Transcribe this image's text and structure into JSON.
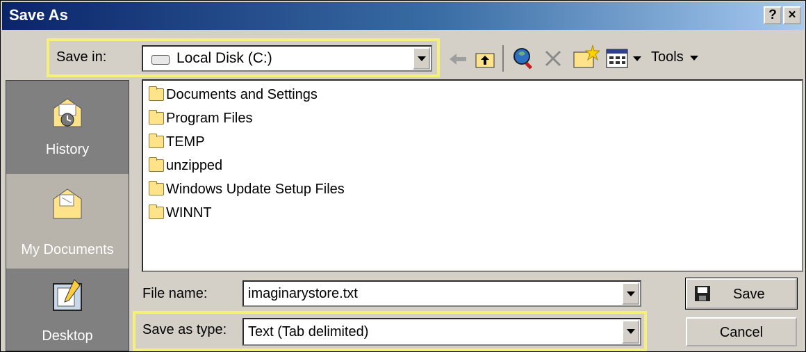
{
  "window": {
    "title": "Save As",
    "help_button": "?",
    "close_button": "×"
  },
  "toolbar": {
    "save_in_label": "Save in:",
    "save_in_value": "Local Disk (C:)",
    "tools_label": "Tools",
    "icons": [
      "back-arrow-icon",
      "up-folder-icon",
      "search-web-icon",
      "delete-icon",
      "new-folder-icon",
      "views-icon"
    ]
  },
  "places": [
    {
      "label": "History",
      "icon": "history-icon"
    },
    {
      "label": "My Documents",
      "icon": "my-documents-icon"
    },
    {
      "label": "Desktop",
      "icon": "desktop-icon"
    }
  ],
  "files": [
    "Documents and Settings",
    "Program Files",
    "TEMP",
    "unzipped",
    "Windows Update Setup Files",
    "WINNT"
  ],
  "form": {
    "file_name_label": "File name:",
    "file_name_value": "imaginarystore.txt",
    "save_type_label": "Save as type:",
    "save_type_value": "Text (Tab delimited)",
    "save_button": "Save",
    "cancel_button": "Cancel"
  },
  "colors": {
    "highlight": "#f5f07a",
    "titlebar_start": "#0a246a",
    "titlebar_end": "#a6caf0",
    "dialog_bg": "#d4d0c8"
  }
}
